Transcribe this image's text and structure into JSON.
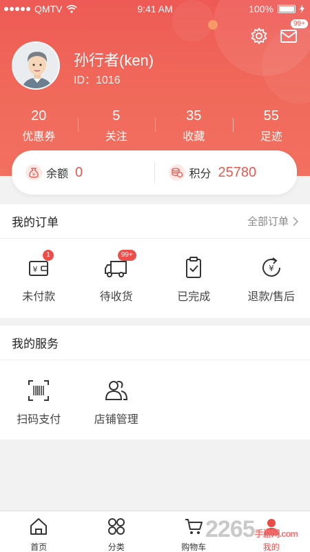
{
  "status": {
    "carrier": "QMTV",
    "time": "9:41 AM",
    "battery": "100%"
  },
  "header": {
    "message_badge": "99+",
    "username": "孙行者(ken)",
    "user_id": "ID：1016",
    "stats": [
      {
        "value": "20",
        "label": "优惠券"
      },
      {
        "value": "5",
        "label": "关注"
      },
      {
        "value": "35",
        "label": "收藏"
      },
      {
        "value": "55",
        "label": "足迹"
      }
    ]
  },
  "wallet": {
    "balance_label": "余额",
    "balance_value": "0",
    "points_label": "积分",
    "points_value": "25780"
  },
  "orders": {
    "title": "我的订单",
    "more": "全部订单",
    "items": [
      {
        "label": "未付款",
        "badge": "1",
        "icon": "wallet-yen-icon"
      },
      {
        "label": "待收货",
        "badge": "99+",
        "icon": "delivery-truck-icon"
      },
      {
        "label": "已完成",
        "badge": "",
        "icon": "clipboard-check-icon"
      },
      {
        "label": "退款/售后",
        "badge": "",
        "icon": "refund-yen-icon"
      }
    ]
  },
  "services": {
    "title": "我的服务",
    "items": [
      {
        "label": "扫码支付",
        "icon": "barcode-scan-icon"
      },
      {
        "label": "店铺管理",
        "icon": "users-icon"
      }
    ]
  },
  "tabbar": {
    "items": [
      {
        "label": "首页",
        "icon": "home-icon"
      },
      {
        "label": "分类",
        "icon": "category-icon"
      },
      {
        "label": "购物车",
        "icon": "cart-icon"
      },
      {
        "label": "我的",
        "icon": "profile-icon"
      }
    ],
    "active": "我的"
  },
  "watermark": {
    "text": "2265",
    "sub": "手游网",
    "domain": ".com"
  },
  "colors": {
    "accent": "#ee5a55",
    "badge": "#ee4e4a",
    "points": "#e55a50"
  }
}
